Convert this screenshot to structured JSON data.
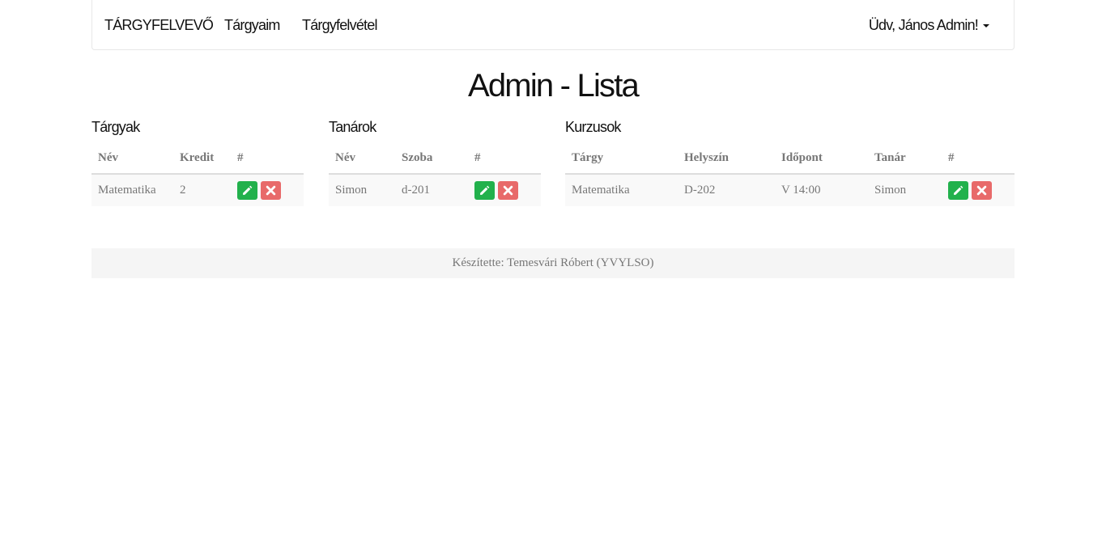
{
  "navbar": {
    "brand": "TÁRGYFELVEVŐ",
    "items": [
      {
        "label": "Tárgyaim"
      },
      {
        "label": "Tárgyfelvétel"
      }
    ],
    "user_menu": "Üdv, János Admin!"
  },
  "page": {
    "title": "Admin - Lista"
  },
  "subjects": {
    "title": "Tárgyak",
    "headers": [
      "Név",
      "Kredit",
      "#"
    ],
    "rows": [
      {
        "name": "Matematika",
        "credit": "2"
      }
    ]
  },
  "teachers": {
    "title": "Tanárok",
    "headers": [
      "Név",
      "Szoba",
      "#"
    ],
    "rows": [
      {
        "name": "Simon",
        "room": "d-201"
      }
    ]
  },
  "courses": {
    "title": "Kurzusok",
    "headers": [
      "Tárgy",
      "Helyszín",
      "Időpont",
      "Tanár",
      "#"
    ],
    "rows": [
      {
        "subject": "Matematika",
        "location": "D-202",
        "time": "V 14:00",
        "teacher": "Simon"
      }
    ]
  },
  "footer": {
    "text": "Készítette: Temesvári Róbert (YVYLSO)"
  },
  "colors": {
    "edit_button": "#22b14c",
    "delete_button": "#e86a6a"
  },
  "icons": {
    "edit": "pencil-icon",
    "delete": "close-icon"
  }
}
